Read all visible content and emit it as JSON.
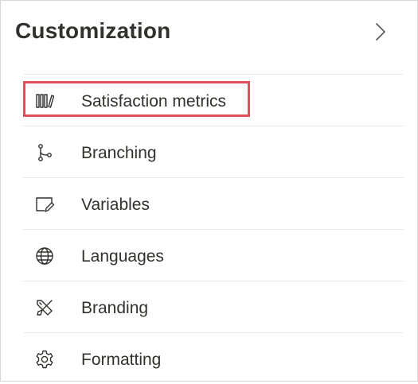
{
  "panel": {
    "title": "Customization",
    "expand_icon": "chevron-right-icon"
  },
  "menu": {
    "items": [
      {
        "label": "Satisfaction metrics",
        "icon": "satisfaction-metrics-icon",
        "highlighted": true
      },
      {
        "label": "Branching",
        "icon": "branching-icon"
      },
      {
        "label": "Variables",
        "icon": "variables-icon"
      },
      {
        "label": "Languages",
        "icon": "globe-icon"
      },
      {
        "label": "Branding",
        "icon": "branding-icon"
      },
      {
        "label": "Formatting",
        "icon": "gear-icon"
      }
    ]
  },
  "colors": {
    "highlight_border": "#e0505b",
    "divider": "#e8e8e8",
    "text": "#323130"
  }
}
